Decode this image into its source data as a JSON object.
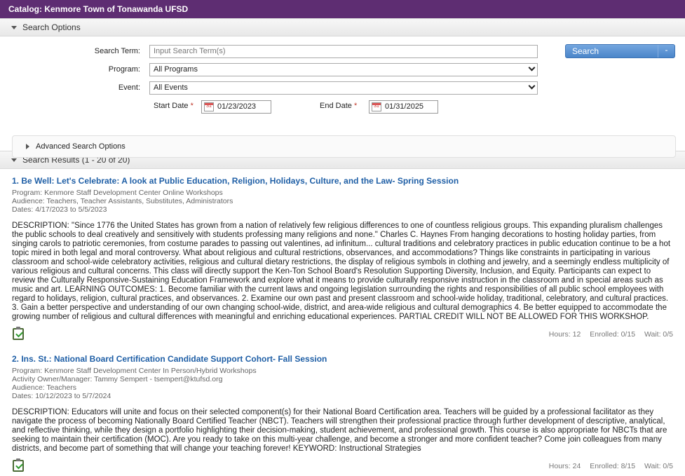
{
  "catalog": {
    "title": "Catalog: Kenmore Town of Tonawanda UFSD"
  },
  "search_options": {
    "header": "Search Options",
    "term_label": "Search Term:",
    "term_placeholder": "Input Search Term(s)",
    "program_label": "Program:",
    "program_value": "All Programs",
    "event_label": "Event:",
    "event_value": "All Events",
    "start_label": "Start Date",
    "start_value": "01/23/2023",
    "end_label": "End Date",
    "end_value": "01/31/2025",
    "required_mark": "*",
    "calendar_day": "31",
    "search_button": "Search",
    "search_dropdown": "-",
    "advanced": "Advanced Search Options"
  },
  "results": {
    "header": "Search Results (1 - 20 of 20)",
    "items": [
      {
        "title": "1. Be Well: Let's Celebrate: A look at Public Education, Religion, Holidays, Culture, and the Law- Spring Session",
        "program": "Program: Kenmore Staff Development Center Online Workshops",
        "audience": "Audience: Teachers, Teacher Assistants, Substitutes, Administrators",
        "dates": "Dates: 4/17/2023 to 5/5/2023",
        "description": "DESCRIPTION: \"Since 1776 the United States has grown from a nation of relatively few religious differences to one of countless religious groups. This expanding pluralism challenges the public schools to deal creatively and sensitively with students professing many religions and none.\" Charles C. Haynes From hanging decorations to hosting holiday parties, from singing carols to patriotic ceremonies, from costume parades to passing out valentines, ad infinitum... cultural traditions and celebratory practices in public education continue to be a hot topic mired in both legal and moral controversy. What about religious and cultural restrictions, observances, and accommodations? Things like constraints in participating in various classroom and school-wide celebratory activities, religious and cultural dietary restrictions, the display of religious symbols in clothing and jewelry, and a seemingly endless multiplicity of various religious and cultural concerns. This class will directly support the Ken-Ton School Board's Resolution Supporting Diversity, Inclusion, and Equity. Participants can expect to review the Culturally Responsive-Sustaining Education Framework and explore what it means to provide culturally responsive instruction in the classroom and in special areas such as music and art. LEARNING OUTCOMES: 1. Become familiar with the current laws and ongoing legislation surrounding the rights and responsibilities of all public school employees with regard to holidays, religion, cultural practices, and observances. 2. Examine our own past and present classroom and school-wide holiday, traditional, celebratory, and cultural practices. 3. Gain a better perspective and understanding of our own changing school-wide, district, and area-wide religious and cultural demographics 4. Be better equipped to accommodate the growing number of religious and cultural differences with meaningful and enriching educational experiences. PARTIAL CREDIT WILL NOT BE ALLOWED FOR THIS WORKSHOP.",
        "hours": "Hours: 12",
        "enrolled": "Enrolled: 0/15",
        "wait": "Wait: 0/5"
      },
      {
        "title": "2. Ins. St.: National Board Certification Candidate Support Cohort- Fall Session",
        "program": "Program: Kenmore Staff Development Center In Person/Hybrid Workshops",
        "owner": "Activity Owner/Manager: Tammy Sempert  - tsempert@ktufsd.org",
        "audience": "Audience: Teachers",
        "dates": "Dates: 10/12/2023 to 5/7/2024",
        "description": "DESCRIPTION: Educators will unite and focus on their selected component(s) for their National Board Certification area. Teachers will be guided by a professional facilitator as they navigate the process of becoming Nationally Board Certified Teacher (NBCT). Teachers will strengthen their professional practice through further development of descriptive, analytical, and reflective thinking, while they design a portfolio highlighting their decision-making, student achievement, and professional growth. This course is also appropriate for NBCTs that are seeking to maintain their certification (MOC). Are you ready to take on this multi-year challenge, and become a stronger and more confident teacher? Come join colleagues from many districts, and become part of something that will change your teaching forever! KEYWORD: Instructional Strategies",
        "hours": "Hours: 24",
        "enrolled": "Enrolled: 8/15",
        "wait": "Wait: 0/5"
      }
    ]
  },
  "icons": {
    "register": "clipboard-check-icon",
    "calendar": "calendar-icon"
  },
  "colors": {
    "titlebar": "#5e2d72",
    "link": "#1f5fa6",
    "button": "#4a85c9"
  }
}
